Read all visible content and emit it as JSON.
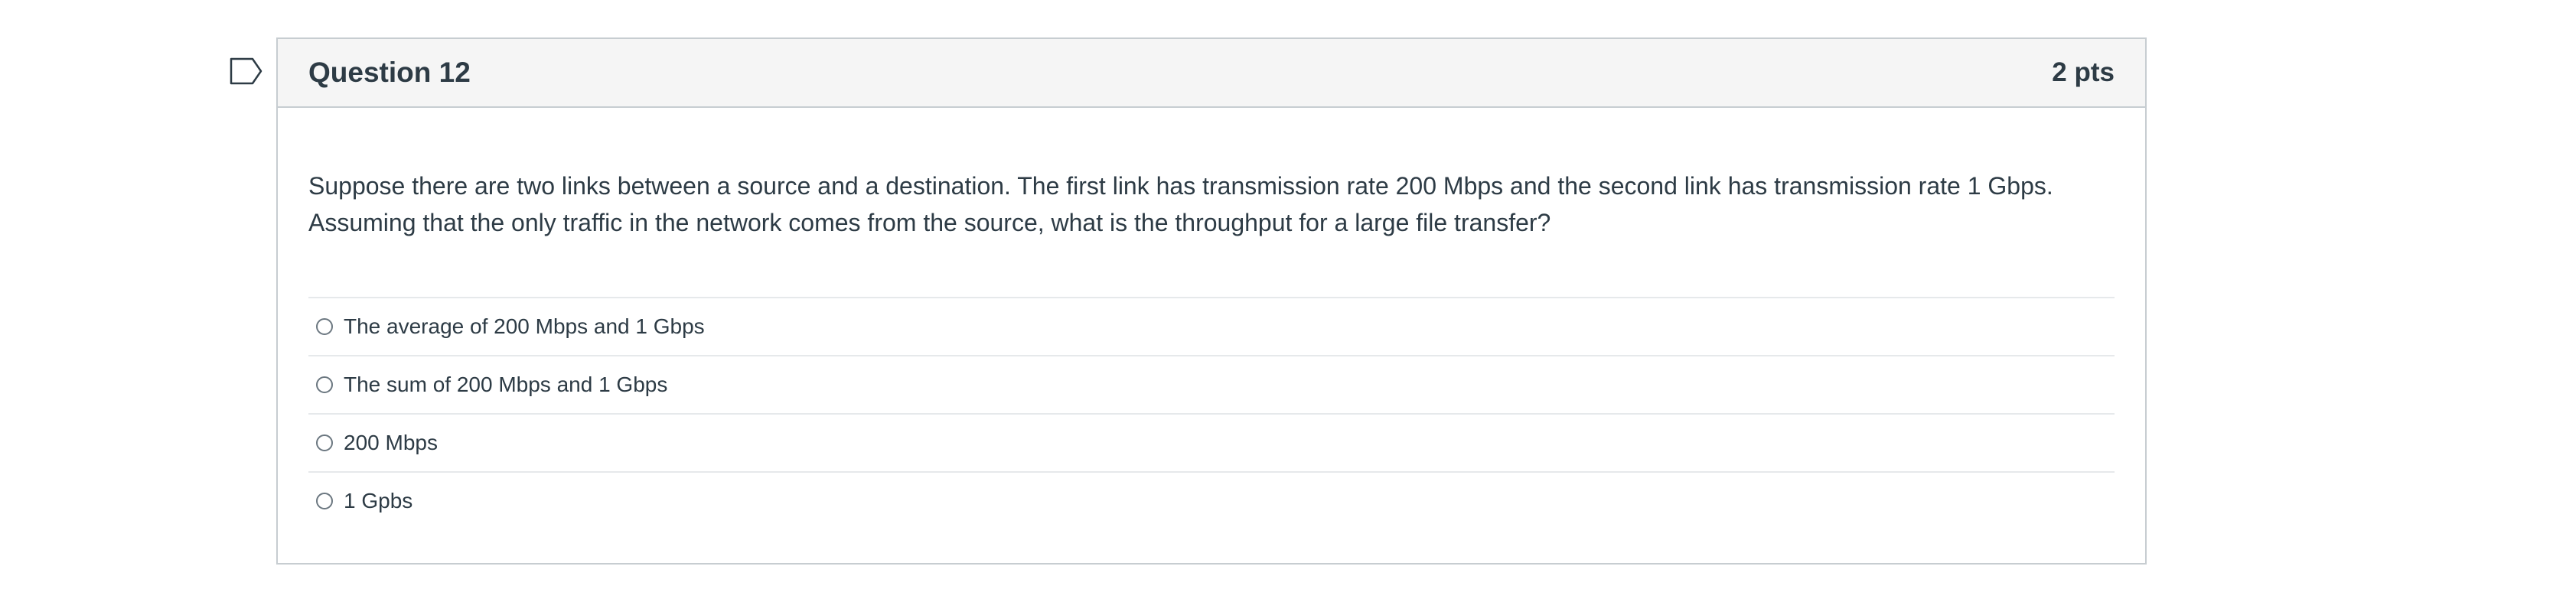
{
  "question": {
    "title": "Question 12",
    "points": "2 pts",
    "text": "Suppose there are two links between a source and a destination. The first link has transmission rate 200 Mbps and the second link has transmission rate 1 Gbps.\nAssuming that the only traffic in the network comes from the source, what is the throughput for a large file transfer?",
    "answers": [
      {
        "label": "The average of 200 Mbps and 1 Gbps",
        "selected": false
      },
      {
        "label": "The sum of 200 Mbps and 1 Gbps",
        "selected": false
      },
      {
        "label": "200 Mbps",
        "selected": false
      },
      {
        "label": "1 Gpbs",
        "selected": false
      }
    ]
  },
  "icons": {
    "flag": "flag-question-icon"
  },
  "colors": {
    "text": "#2d3b45",
    "border": "#c7cdd1",
    "header_bg": "#f5f5f5"
  }
}
